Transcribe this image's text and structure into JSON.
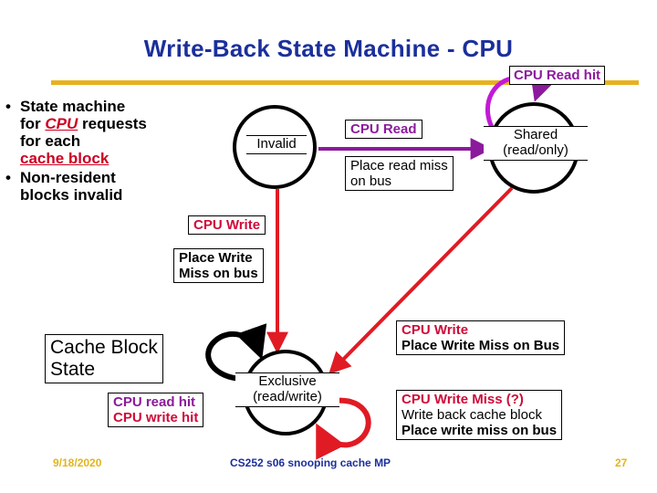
{
  "slide": {
    "title": "Write-Back State Machine - CPU",
    "accent_gold": "#e8b21e",
    "title_blue": "#1b2f9c",
    "purple": "#8c1a9c",
    "crimson": "#cf0a38"
  },
  "bullets": [
    {
      "marker": "•",
      "parts": [
        {
          "text": "State machine ",
          "style": "plain"
        },
        {
          "text": "for ",
          "style": "plain"
        },
        {
          "text": "CPU",
          "style": "red-italic-underline"
        },
        {
          "text": " requests ",
          "style": "plain"
        },
        {
          "text": "for each ",
          "style": "plain"
        },
        {
          "text": "cache block",
          "style": "red-underline"
        }
      ],
      "line1": "State machine",
      "line2_pre": "for ",
      "line2_em": "CPU",
      "line2_post": " requests",
      "line3": "for each",
      "line4_em": "cache block"
    },
    {
      "marker": "•",
      "line1": "Non-resident",
      "line2": "blocks invalid"
    }
  ],
  "states": [
    {
      "id": "invalid",
      "label": "Invalid"
    },
    {
      "id": "shared",
      "line1": "Shared",
      "line2": "(read/only)"
    },
    {
      "id": "exclusive",
      "line1": "Exclusive",
      "line2": "(read/write)"
    }
  ],
  "transitions": {
    "cpu_read_hit": "CPU Read hit",
    "cpu_read": "CPU Read",
    "place_read_miss_l1": "Place read miss",
    "place_read_miss_l2": "on bus",
    "cpu_write_left": "CPU Write",
    "place_write_miss_left_l1": "Place Write",
    "place_write_miss_left_l2": "Miss on bus",
    "cpu_write_right": "CPU Write",
    "place_write_miss_right": "Place Write Miss on Bus",
    "cpu_write_miss": "CPU Write Miss (?)",
    "write_back_cache_block": "Write back cache block",
    "place_write_miss_on_bus": "Place write miss on bus",
    "cpu_read_hit_small": "CPU read hit",
    "cpu_write_hit_small": "CPU write hit"
  },
  "cache_state_box": {
    "line1": "Cache Block",
    "line2": "State"
  },
  "footer": {
    "date": "9/18/2020",
    "center": "CS252 s06 snooping cache MP",
    "page": "27"
  }
}
